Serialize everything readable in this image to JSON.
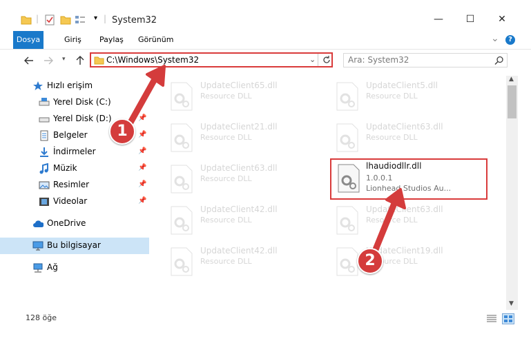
{
  "window": {
    "title": "System32",
    "minimize": "—",
    "maximize": "☐",
    "close": "✕"
  },
  "ribbon": {
    "tabs": [
      "Dosya",
      "Giriş",
      "Paylaş",
      "Görünüm"
    ],
    "expand": "⌄",
    "help": "?"
  },
  "address": {
    "path": "C:\\Windows\\System32"
  },
  "search": {
    "placeholder": "Ara: System32"
  },
  "nav": {
    "quick_access": "Hızlı erişim",
    "items": [
      {
        "label": "Yerel Disk (C:)"
      },
      {
        "label": "Yerel Disk (D:)"
      },
      {
        "label": "Belgeler"
      },
      {
        "label": "İndirmeler"
      },
      {
        "label": "Müzik"
      },
      {
        "label": "Resimler"
      },
      {
        "label": "Videolar"
      }
    ],
    "onedrive": "OneDrive",
    "this_pc": "Bu bilgisayar",
    "network": "Ağ"
  },
  "files": [
    {
      "name": "UpdateClient65.dll",
      "desc": "Resource DLL"
    },
    {
      "name": "UpdateClient5.dll",
      "desc": "Resource DLL"
    },
    {
      "name": "UpdateClient21.dll",
      "desc": "Resource DLL"
    },
    {
      "name": "UpdateClient63.dll",
      "desc": "Resource DLL"
    },
    {
      "name": "UpdateClient63.dll",
      "desc": "Resource DLL"
    },
    {
      "name": "lhaudiodllr.dll",
      "version": "1.0.0.1",
      "company": "Lionhead Studios Au..."
    },
    {
      "name": "UpdateClient42.dll",
      "desc": "Resource DLL"
    },
    {
      "name": "UpdateClient63.dll",
      "desc": "Resource DLL"
    },
    {
      "name": "UpdateClient42.dll",
      "desc": "Resource DLL"
    },
    {
      "name": "UpdateClient19.dll",
      "desc": "Resource DLL"
    }
  ],
  "status": {
    "count": "128 öğe"
  },
  "badges": [
    "1",
    "2"
  ],
  "colors": {
    "accent": "#1979ca",
    "highlight": "#d93a3a",
    "selection": "#cce4f7"
  }
}
